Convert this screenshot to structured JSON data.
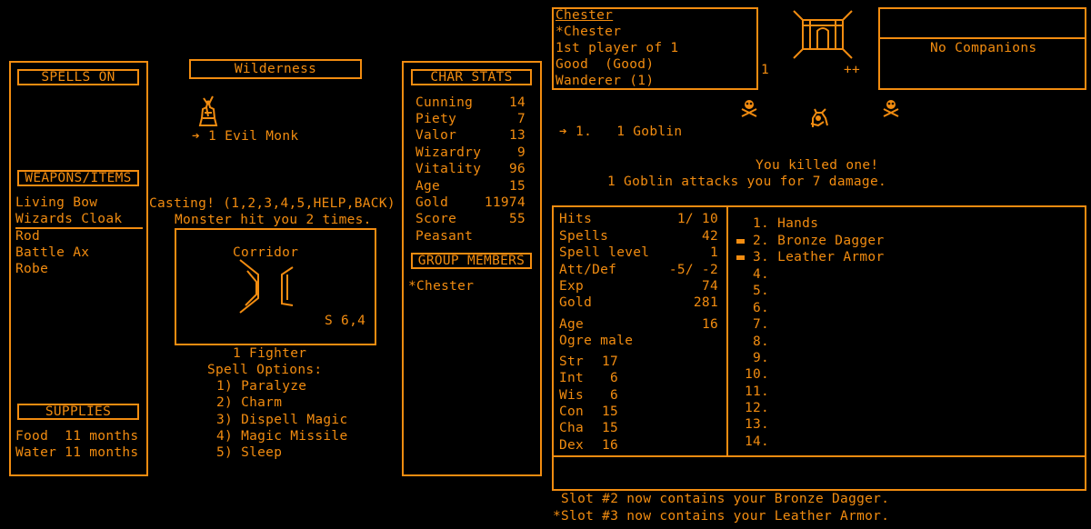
{
  "spells_panel": {
    "spells_header": "SPELLS ON",
    "weapons_header": "WEAPONS/ITEMS",
    "items": [
      "Living Bow",
      "Wizards Cloak",
      "Rod",
      "Battle Ax",
      "Robe"
    ],
    "supplies_header": "SUPPLIES",
    "food": "Food  11 months",
    "water": "Water 11 months"
  },
  "wilderness": {
    "title": "Wilderness",
    "monster_label": "➔ 1 Evil Monk",
    "casting": "Casting! (1,2,3,4,5,HELP,BACK)",
    "hit_msg": "Monster hit you 2 times.",
    "corridor_label": "Corridor",
    "coords": "S 6,4",
    "fighter": "1 Fighter",
    "spell_options_title": "Spell Options:",
    "spell_options": [
      "1) Paralyze",
      "2) Charm",
      "3) Dispell Magic",
      "4) Magic Missile",
      "5) Sleep"
    ]
  },
  "char_stats": {
    "header": "CHAR STATS",
    "stats": [
      {
        "label": "Cunning",
        "value": "14"
      },
      {
        "label": "Piety",
        "value": "7"
      },
      {
        "label": "Valor",
        "value": "13"
      },
      {
        "label": "Wizardry",
        "value": "9"
      },
      {
        "label": "Vitality",
        "value": "96"
      },
      {
        "label": "Age",
        "value": "15"
      },
      {
        "label": "Gold",
        "value": "11974"
      },
      {
        "label": "Score",
        "value": "55"
      }
    ],
    "title": "Peasant",
    "group_header": "GROUP MEMBERS",
    "group_members": [
      "*Chester"
    ]
  },
  "player_info": {
    "name": "Chester",
    "lines": [
      "*Chester",
      "1st player of 1",
      "Good  (Good)",
      "Wanderer (1)"
    ],
    "left_num": "1",
    "right_marks": "++"
  },
  "companions": {
    "text": "No Companions"
  },
  "encounter": {
    "target": "➔ 1.   1 Goblin",
    "kill_msg": "You killed one!",
    "attack_msg": "1 Goblin attacks you for 7 damage."
  },
  "status": {
    "rows": [
      {
        "label": "Hits",
        "value": "1/ 10"
      },
      {
        "label": "Spells",
        "value": "42"
      },
      {
        "label": "Spell level",
        "value": "1"
      },
      {
        "label": "Att/Def",
        "value": "-5/ -2"
      },
      {
        "label": "Exp",
        "value": "74"
      },
      {
        "label": "Gold",
        "value": "281"
      }
    ],
    "age_label": "Age",
    "age_value": "16",
    "race": "Ogre male",
    "attrs": [
      {
        "label": "Str",
        "value": "17"
      },
      {
        "label": "Int",
        "value": "6"
      },
      {
        "label": "Wis",
        "value": "6"
      },
      {
        "label": "Con",
        "value": "15"
      },
      {
        "label": "Cha",
        "value": "15"
      },
      {
        "label": "Dex",
        "value": "16"
      }
    ]
  },
  "inventory": {
    "slots": [
      "1. Hands",
      "2. Bronze Dagger",
      "3. Leather Armor",
      "4.",
      "5.",
      "6.",
      "7.",
      "8.",
      "9.",
      "10.",
      "11.",
      "12.",
      "13.",
      "14."
    ],
    "equipped": [
      false,
      true,
      true,
      false,
      false,
      false,
      false,
      false,
      false,
      false,
      false,
      false,
      false,
      false
    ]
  },
  "messages": [
    " Slot #2 now contains your Bronze Dagger.",
    "*Slot #3 now contains your Leather Armor."
  ],
  "colors": {
    "accent": "#f28c10",
    "background": "#000000"
  }
}
